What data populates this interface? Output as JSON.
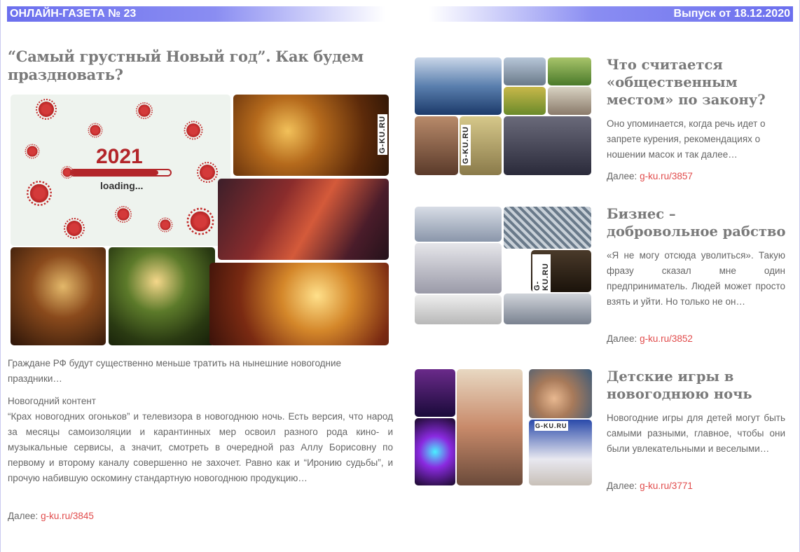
{
  "header": {
    "left_title": "ОНЛАЙН-ГАЗЕТА № 23",
    "right_title": "Выпуск от 18.12.2020"
  },
  "colors": {
    "accent": "#6b6fee",
    "link": "#e14b4b",
    "heading": "#7a7a7a"
  },
  "main_article": {
    "title": "“Самый грустный Новый год”. Как будем праздновать?",
    "collage": {
      "year_text": "2021",
      "loading_text": "loading...",
      "watermark": "G-KU.RU",
      "loading_progress": 0.88
    },
    "lead": "Граждане РФ будут существенно меньше тратить на нынешние новогодние праздники…",
    "section_label": "Новогодний контент",
    "body": "“Крах новогодних огоньков” и телевизора в новогоднюю ночь. Есть версия, что народ за месяцы самоизоляции и карантинных мер освоил разного рода кино- и музыкальные сервисы, а значит, смотреть в очередной раз Аллу Борисовну по первому и второму каналу совершенно не захочет. Равно как и “Иронию судьбы”, и прочую набившую оскомину стандартную новогоднюю продукцию…",
    "more_label": "Далее:",
    "more_link": "g-ku.ru/3845"
  },
  "side_articles": [
    {
      "title": "Что считается «общественным местом» по закону?",
      "text": "Оно упоминается, когда речь идет о запрете курения, рекомендациях о ношении масок и так далее…",
      "more_label": "Далее:",
      "more_link": "g-ku.ru/3857",
      "watermark": "G-KU.RU"
    },
    {
      "title": "Бизнес – добровольное рабство",
      "text": "«Я не могу отсюда уволиться». Такую фразу сказал мне один предприниматель. Людей может просто взять и уйти. Но только не он…",
      "more_label": "Далее:",
      "more_link": "g-ku.ru/3852",
      "watermark": "G-KU.RU"
    },
    {
      "title": "Детские игры в новогоднюю ночь",
      "text": "Новогодние игры для детей могут быть самыми разными, главное, чтобы они были увлекательными и веселыми…",
      "more_label": "Далее:",
      "more_link": "g-ku.ru/3771",
      "watermark": "G-KU.RU"
    }
  ]
}
